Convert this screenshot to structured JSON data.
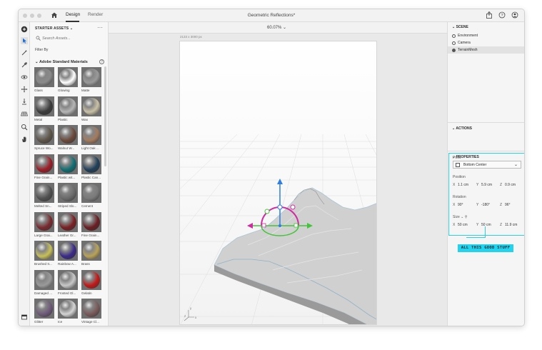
{
  "titlebar": {
    "tabs": [
      {
        "label": "Design",
        "active": true
      },
      {
        "label": "Render",
        "active": false
      }
    ],
    "document_title": "Geometric Reflections*"
  },
  "assets": {
    "header": "STARTER ASSETS",
    "search_placeholder": "Search Assets...",
    "filter_label": "Filter By",
    "section_title": "Adobe Standard Materials",
    "materials": [
      {
        "label": "Glass",
        "color": "#8a8a8a"
      },
      {
        "label": "Glowing",
        "color": "#ffffff"
      },
      {
        "label": "Matte",
        "color": "#9a9a9a"
      },
      {
        "label": "Metal",
        "color": "#3c3c3c"
      },
      {
        "label": "Plastic",
        "color": "#b5b5b5"
      },
      {
        "label": "Wax",
        "color": "#c9c1a6"
      },
      {
        "label": "Spruce Wo...",
        "color": "#5d5548"
      },
      {
        "label": "Walnut W...",
        "color": "#6b4a3a"
      },
      {
        "label": "Light Oak ...",
        "color": "#a37b5e"
      },
      {
        "label": "Fine Grain...",
        "color": "#9e1c26"
      },
      {
        "label": "Plastic wit...",
        "color": "#0f6f73"
      },
      {
        "label": "Plastic Can...",
        "color": "#1f3f5a"
      },
      {
        "label": "Melted Sn...",
        "color": "#505050"
      },
      {
        "label": "Striped Slo...",
        "color": "#6a6a6a"
      },
      {
        "label": "Cement",
        "color": "#7a7a7a"
      },
      {
        "label": "Large Grai...",
        "color": "#7a2a2e"
      },
      {
        "label": "Leather Gr...",
        "color": "#7a1f22"
      },
      {
        "label": "Fine Grain...",
        "color": "#6a1e22"
      },
      {
        "label": "Brushed It...",
        "color": "#c7c05a"
      },
      {
        "label": "Rainbow A...",
        "color": "#3b2a8a"
      },
      {
        "label": "Brass",
        "color": "#b8a25a"
      },
      {
        "label": "Damaged ...",
        "color": "#9a9a9a"
      },
      {
        "label": "Frosted Gl...",
        "color": "#c8c8c8"
      },
      {
        "label": "Gelatin",
        "color": "#c41818"
      },
      {
        "label": "Glitter",
        "color": "#6e5a7a"
      },
      {
        "label": "Ice",
        "color": "#d4d4d4"
      },
      {
        "label": "Vintage Cl...",
        "color": "#7a5a5a"
      }
    ]
  },
  "viewport": {
    "zoom": "60.07%",
    "dimensions": "2133 x 3000 px"
  },
  "scene": {
    "header": "SCENE",
    "items": [
      {
        "label": "Environment",
        "selected": false
      },
      {
        "label": "Camera",
        "selected": false
      },
      {
        "label": "TerrainMesh",
        "selected": true
      }
    ]
  },
  "actions": {
    "header": "ACTIONS"
  },
  "properties": {
    "header": "PROPERTIES",
    "pivot_label": "Pivot",
    "pivot_value": "Bottom Center",
    "position_label": "Position",
    "position": {
      "x": "1.1 cm",
      "y": "5.9 cm",
      "z": "0.9 cm"
    },
    "rotation_label": "Rotation",
    "rotation": {
      "x": "90°",
      "y": "-180°",
      "z": "96°"
    },
    "size_label": "Size",
    "size": {
      "x": "50 cm",
      "y": "50 cm",
      "z": "11.9 cm"
    },
    "axis_x": "X",
    "axis_y": "Y",
    "axis_z": "Z"
  },
  "callout": "ALL THIS GOOD STUFF"
}
